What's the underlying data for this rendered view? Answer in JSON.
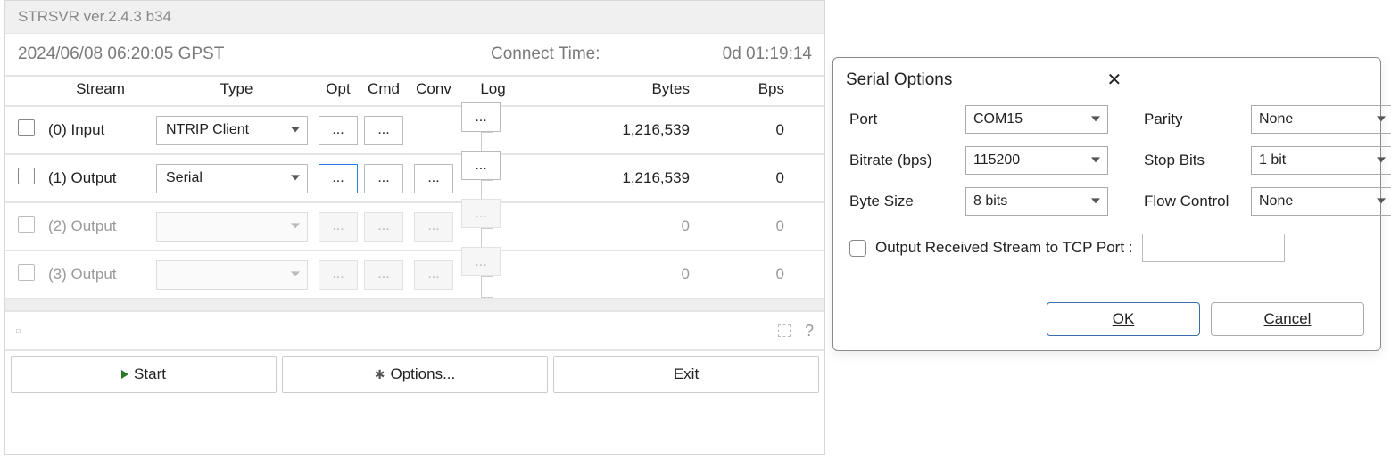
{
  "window": {
    "title": "STRSVR ver.2.4.3 b34"
  },
  "status": {
    "time": "2024/06/08 06:20:05 GPST",
    "connect_label": "Connect Time:",
    "connect_time": "0d 01:19:14"
  },
  "headers": {
    "stream": "Stream",
    "type": "Type",
    "opt": "Opt",
    "cmd": "Cmd",
    "conv": "Conv",
    "log": "Log",
    "bytes": "Bytes",
    "bps": "Bps"
  },
  "streams": [
    {
      "label": "(0) Input",
      "type": "NTRIP Client",
      "type_enabled": true,
      "has_conv": false,
      "opt_selected": false,
      "bytes": "1,216,539",
      "bps": "0",
      "enabled": true
    },
    {
      "label": "(1) Output",
      "type": "Serial",
      "type_enabled": true,
      "has_conv": true,
      "opt_selected": true,
      "bytes": "1,216,539",
      "bps": "0",
      "enabled": true
    },
    {
      "label": "(2) Output",
      "type": "",
      "type_enabled": false,
      "has_conv": true,
      "opt_selected": false,
      "bytes": "0",
      "bps": "0",
      "enabled": false
    },
    {
      "label": "(3) Output",
      "type": "",
      "type_enabled": false,
      "has_conv": true,
      "opt_selected": false,
      "bytes": "0",
      "bps": "0",
      "enabled": false
    }
  ],
  "dots": "...",
  "qmark": "?",
  "buttons": {
    "start": "Start",
    "options": "Options...",
    "exit": "Exit"
  },
  "dialog": {
    "title": "Serial Options",
    "port_label": "Port",
    "port_value": "COM15",
    "bitrate_label": "Bitrate (bps)",
    "bitrate_value": "115200",
    "bytesize_label": "Byte Size",
    "bytesize_value": "8 bits",
    "parity_label": "Parity",
    "parity_value": "None",
    "stopbits_label": "Stop Bits",
    "stopbits_value": "1 bit",
    "flow_label": "Flow Control",
    "flow_value": "None",
    "tcp_label": "Output Received Stream to  TCP Port :",
    "ok": "OK",
    "cancel": "Cancel"
  }
}
